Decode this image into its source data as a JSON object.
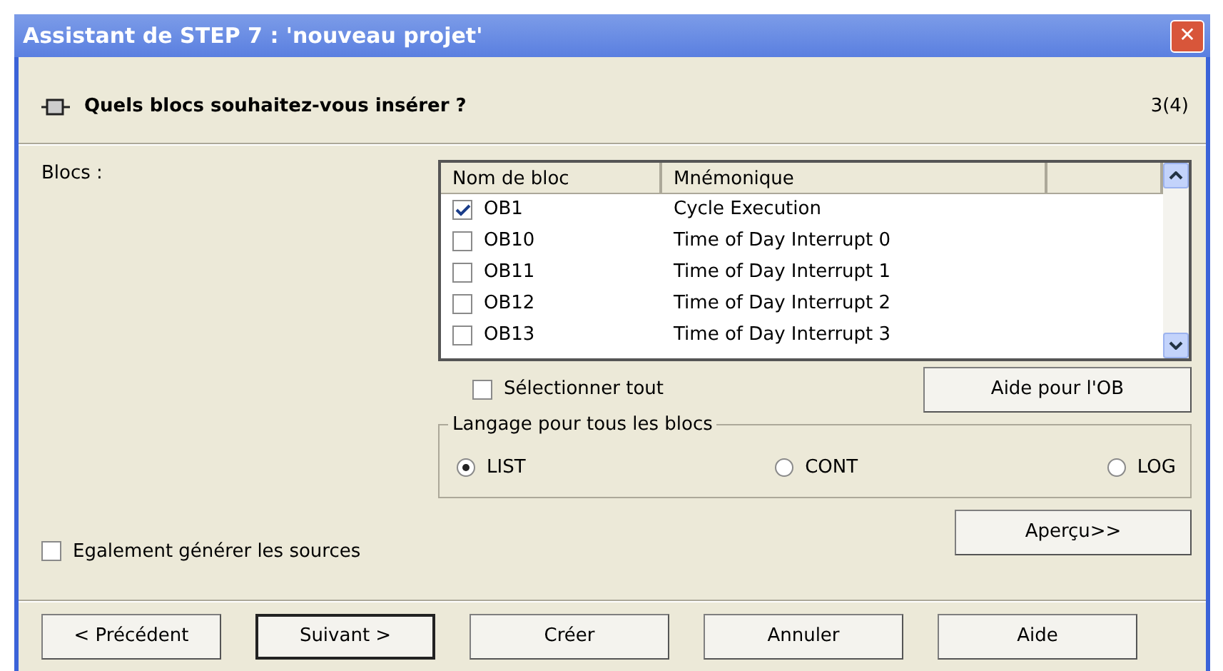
{
  "window": {
    "title": "Assistant de STEP 7 : 'nouveau projet'",
    "close": "✕"
  },
  "header": {
    "question": "Quels blocs souhaitez-vous insérer ?",
    "step": "3(4)"
  },
  "blocks_label": "Blocs :",
  "table": {
    "columns": [
      "Nom de bloc",
      "Mnémonique"
    ],
    "rows": [
      {
        "name": "OB1",
        "mnemonic": "Cycle Execution",
        "checked": true
      },
      {
        "name": "OB10",
        "mnemonic": "Time of Day Interrupt 0",
        "checked": false
      },
      {
        "name": "OB11",
        "mnemonic": "Time of Day Interrupt 1",
        "checked": false
      },
      {
        "name": "OB12",
        "mnemonic": "Time of Day Interrupt 2",
        "checked": false
      },
      {
        "name": "OB13",
        "mnemonic": "Time of Day Interrupt 3",
        "checked": false
      }
    ]
  },
  "select_all": {
    "label": "Sélectionner tout",
    "checked": false
  },
  "ob_help_button": "Aide pour l'OB",
  "language_group": {
    "title": "Langage pour tous les blocs",
    "options": [
      {
        "label": "LIST",
        "selected": true
      },
      {
        "label": "CONT",
        "selected": false
      },
      {
        "label": "LOG",
        "selected": false
      }
    ]
  },
  "generate_sources": {
    "label": "Egalement générer les sources",
    "checked": false
  },
  "preview_button": "Aperçu>>",
  "buttons": [
    {
      "label": "< Précédent",
      "default": false
    },
    {
      "label": "Suivant >",
      "default": true
    },
    {
      "label": "Créer",
      "default": false
    },
    {
      "label": "Annuler",
      "default": false
    },
    {
      "label": "Aide",
      "default": false
    }
  ]
}
